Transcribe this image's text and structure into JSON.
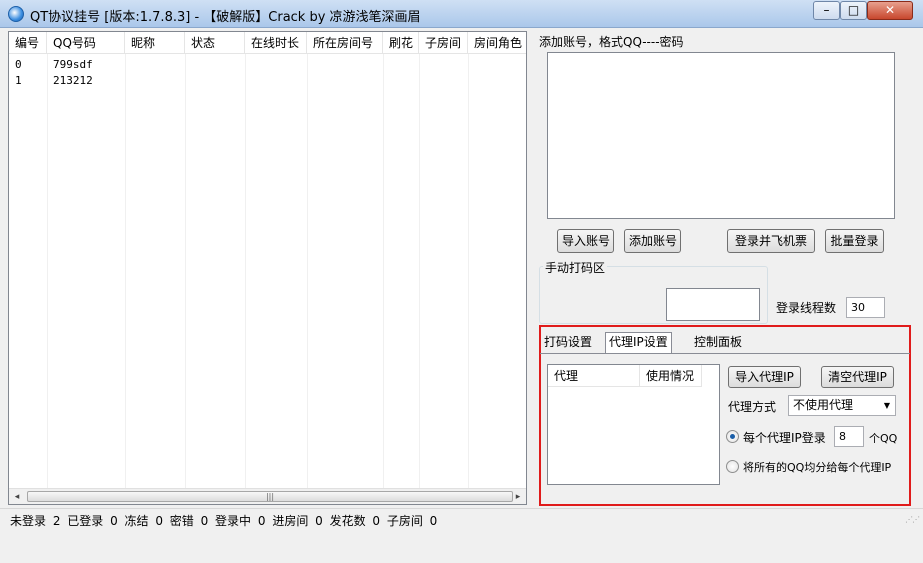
{
  "window": {
    "title": "QT协议挂号 [版本:1.7.8.3] - 【破解版】Crack by 凉游浅笔深画眉",
    "minimize": "–",
    "maximize": "□",
    "close": "✕"
  },
  "account_table": {
    "columns": [
      "编号",
      "QQ号码",
      "昵称",
      "状态",
      "在线时长",
      "所在房间号",
      "刷花",
      "子房间",
      "房间角色"
    ],
    "rows": [
      {
        "id": "0",
        "qq": "799sdf"
      },
      {
        "id": "1",
        "qq": "213212"
      }
    ],
    "scroll_left": "◂",
    "scroll_right": "▸",
    "scroll_thumb": "|||"
  },
  "accounts_panel": {
    "add_label": "添加账号，格式QQ----密码",
    "import_button": "导入账号",
    "add_button": "添加账号",
    "login_ticket_button": "登录并飞机票",
    "batch_login_button": "批量登录",
    "captcha_label": "手动打码区",
    "thread_label": "登录线程数",
    "thread_value": "30"
  },
  "tabs": {
    "items": [
      "打码设置",
      "代理IP设置",
      "控制面板"
    ],
    "active": "代理IP设置"
  },
  "proxy": {
    "columns": [
      "代理",
      "使用情况"
    ],
    "import_button": "导入代理IP",
    "clear_button": "清空代理IP",
    "mode_label": "代理方式",
    "mode_value": "不使用代理",
    "per_proxy_label": "每个代理IP登录",
    "per_proxy_value": "8",
    "per_proxy_unit": "个QQ",
    "distribute_label": "将所有的QQ均分给每个代理IP"
  },
  "status_bar": {
    "text": "未登录 2 已登录 0 冻结 0 密错 0 登录中 0 进房间 0 发花数 0 子房间 0"
  }
}
